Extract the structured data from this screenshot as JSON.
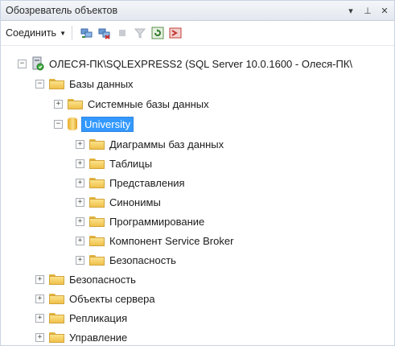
{
  "panel": {
    "title": "Обозреватель объектов",
    "title_icons": [
      "pin-dropdown-icon",
      "auto-hide-pin-icon",
      "close-icon"
    ]
  },
  "toolbar": {
    "connect_label": "Соединить",
    "icons": [
      "connect-object-explorer-icon",
      "disconnect-icon",
      "stop-icon",
      "filter-icon",
      "refresh-icon",
      "start-powershell-icon"
    ]
  },
  "tree": {
    "server": "ОЛЕСЯ-ПК\\SQLEXPRESS2 (SQL Server 10.0.1600 - Олеся-ПК\\",
    "databases": "Базы данных",
    "system_databases": "Системные базы данных",
    "university": "University",
    "university_children": [
      "Диаграммы баз данных",
      "Таблицы",
      "Представления",
      "Синонимы",
      "Программирование",
      "Компонент Service Broker",
      "Безопасность"
    ],
    "server_children": [
      "Безопасность",
      "Объекты сервера",
      "Репликация",
      "Управление"
    ]
  },
  "colors": {
    "selection": "#3399ff",
    "folder": "#f0c14b",
    "titlebar": "#e3e8ef"
  }
}
